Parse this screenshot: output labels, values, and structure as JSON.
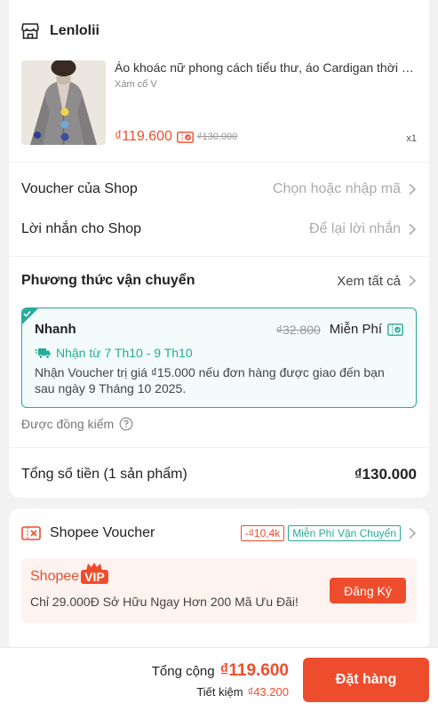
{
  "shop": {
    "name": "Lenlolii",
    "icon": "store-icon"
  },
  "product": {
    "title": "Áo khoác nữ phong cách tiểu thư, áo Cardigan thời trang",
    "variant": "Xám cổ V",
    "price": "₫119.600",
    "original_price": "₫130.000",
    "quantity": "x1"
  },
  "shop_voucher": {
    "label": "Voucher của Shop",
    "placeholder": "Chọn hoặc nhập mã"
  },
  "shop_message": {
    "label": "Lời nhắn cho Shop",
    "placeholder": "Để lại lời nhắn"
  },
  "shipping": {
    "title": "Phương thức vận chuyển",
    "see_all": "Xem tất cả",
    "option": {
      "name": "Nhanh",
      "old_fee": "₫32.800",
      "fee": "Miễn Phí",
      "eta": "Nhận từ 7 Th10 - 9 Th10",
      "note": "Nhận Voucher trị giá ₫15.000 nếu đơn hàng được giao đến bạn sau ngày 9 Tháng 10 2025."
    },
    "cod_check": "Được đồng kiểm"
  },
  "order_total": {
    "label": "Tổng số tiền (1 sản phẩm)",
    "value": "₫130.000"
  },
  "shopee_voucher": {
    "label": "Shopee Voucher",
    "tags": [
      "-₫10,4k",
      "Miễn Phí Vận Chuyển"
    ]
  },
  "vip": {
    "logo_text": "Shopee",
    "badge": "VIP",
    "promo": "Chỉ 29.000Đ Sở Hữu Ngay Hơn 200 Mã Ưu Đãi!",
    "button": "Đăng Ký"
  },
  "footer": {
    "total_label": "Tổng cộng",
    "total_value": "₫119.600",
    "savings_label": "Tiết kiệm",
    "savings_value": "₫43.200",
    "order_button": "Đặt hàng"
  },
  "colors": {
    "accent": "#ee4d2d",
    "teal": "#26aa99"
  }
}
